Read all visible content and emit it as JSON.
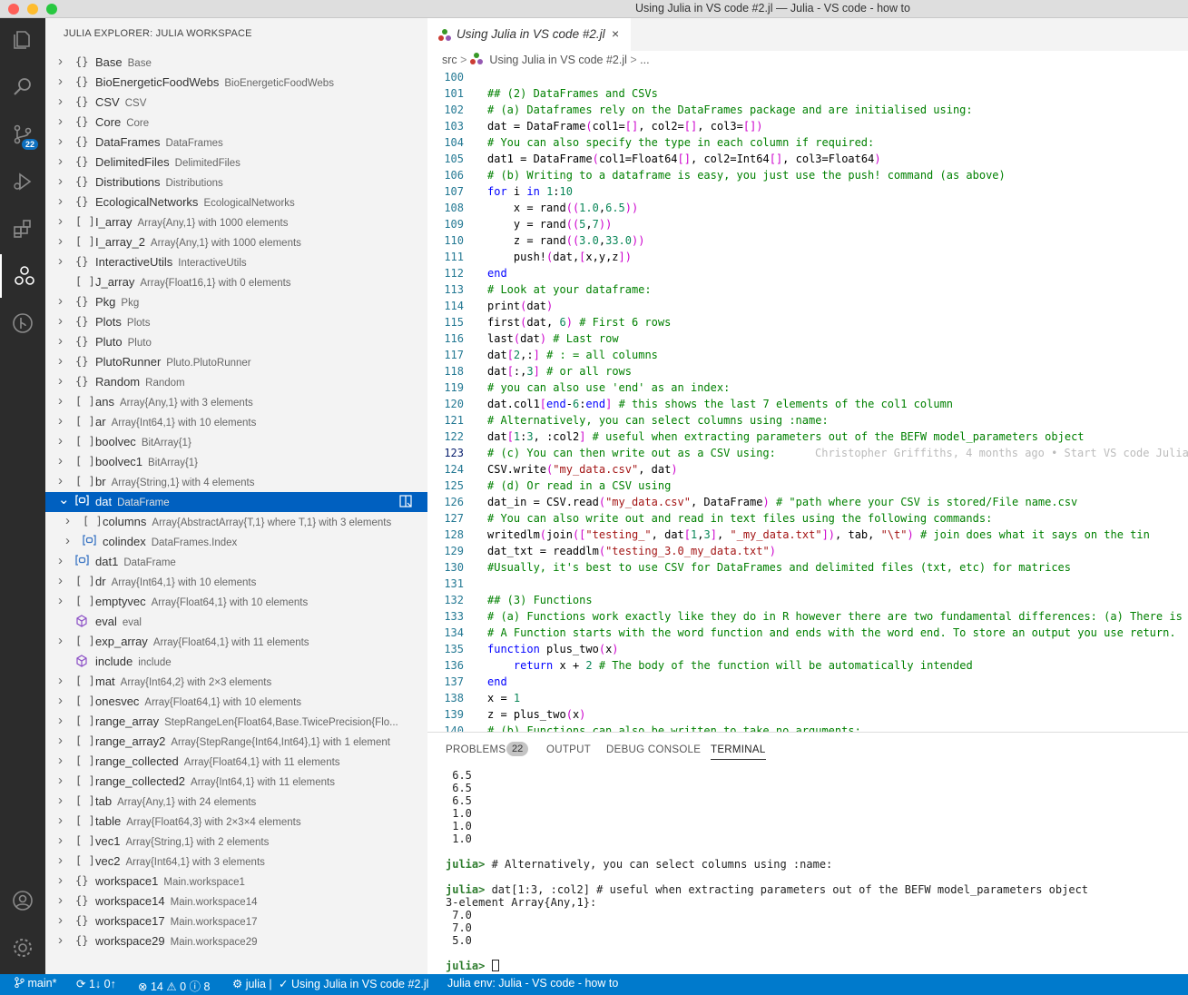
{
  "window": {
    "title": "Using Julia in VS code #2.jl — Julia - VS code - how to"
  },
  "activity": {
    "scm_badge": "22"
  },
  "explorer": {
    "title": "JULIA EXPLORER: JULIA WORKSPACE",
    "items": [
      {
        "icon": "{}",
        "name": "Base",
        "desc": "Base",
        "tw": ">"
      },
      {
        "icon": "{}",
        "name": "BioEnergeticFoodWebs",
        "desc": "BioEnergeticFoodWebs",
        "tw": ">"
      },
      {
        "icon": "{}",
        "name": "CSV",
        "desc": "CSV",
        "tw": ">"
      },
      {
        "icon": "{}",
        "name": "Core",
        "desc": "Core",
        "tw": ">"
      },
      {
        "icon": "{}",
        "name": "DataFrames",
        "desc": "DataFrames",
        "tw": ">"
      },
      {
        "icon": "{}",
        "name": "DelimitedFiles",
        "desc": "DelimitedFiles",
        "tw": ">"
      },
      {
        "icon": "{}",
        "name": "Distributions",
        "desc": "Distributions",
        "tw": ">"
      },
      {
        "icon": "{}",
        "name": "EcologicalNetworks",
        "desc": "EcologicalNetworks",
        "tw": ">"
      },
      {
        "icon": "[ ]",
        "name": "I_array",
        "desc": "Array{Any,1} with 1000 elements",
        "tw": ">"
      },
      {
        "icon": "[ ]",
        "name": "I_array_2",
        "desc": "Array{Any,1} with 1000 elements",
        "tw": ">"
      },
      {
        "icon": "{}",
        "name": "InteractiveUtils",
        "desc": "InteractiveUtils",
        "tw": ">"
      },
      {
        "icon": "[ ]",
        "name": "J_array",
        "desc": "Array{Float16,1} with 0 elements",
        "tw": ""
      },
      {
        "icon": "{}",
        "name": "Pkg",
        "desc": "Pkg",
        "tw": ">"
      },
      {
        "icon": "{}",
        "name": "Plots",
        "desc": "Plots",
        "tw": ">"
      },
      {
        "icon": "{}",
        "name": "Pluto",
        "desc": "Pluto",
        "tw": ">"
      },
      {
        "icon": "{}",
        "name": "PlutoRunner",
        "desc": "Pluto.PlutoRunner",
        "tw": ">"
      },
      {
        "icon": "{}",
        "name": "Random",
        "desc": "Random",
        "tw": ">"
      },
      {
        "icon": "[ ]",
        "name": "ans",
        "desc": "Array{Any,1} with 3 elements",
        "tw": ">"
      },
      {
        "icon": "[ ]",
        "name": "ar",
        "desc": "Array{Int64,1} with 10 elements",
        "tw": ">"
      },
      {
        "icon": "[ ]",
        "name": "boolvec",
        "desc": "BitArray{1}",
        "tw": ">"
      },
      {
        "icon": "[ ]",
        "name": "boolvec1",
        "desc": "BitArray{1}",
        "tw": ">"
      },
      {
        "icon": "[ ]",
        "name": "br",
        "desc": "Array{String,1} with 4 elements",
        "tw": ">"
      },
      {
        "icon": "[o]",
        "name": "dat",
        "desc": "DataFrame",
        "tw": "v",
        "sel": true
      },
      {
        "icon": "[ ]",
        "name": "columns",
        "desc": "Array{AbstractArray{T,1} where T,1} with 3 elements",
        "tw": ">",
        "indent": 1
      },
      {
        "icon": "[o]",
        "name": "colindex",
        "desc": "DataFrames.Index",
        "tw": ">",
        "indent": 1
      },
      {
        "icon": "[o]",
        "name": "dat1",
        "desc": "DataFrame",
        "tw": ">"
      },
      {
        "icon": "[ ]",
        "name": "dr",
        "desc": "Array{Int64,1} with 10 elements",
        "tw": ">"
      },
      {
        "icon": "[ ]",
        "name": "emptyvec",
        "desc": "Array{Float64,1} with 10 elements",
        "tw": ">"
      },
      {
        "icon": "cube",
        "name": "eval",
        "desc": "eval",
        "tw": ""
      },
      {
        "icon": "[ ]",
        "name": "exp_array",
        "desc": "Array{Float64,1} with 11 elements",
        "tw": ">"
      },
      {
        "icon": "cube",
        "name": "include",
        "desc": "include",
        "tw": ""
      },
      {
        "icon": "[ ]",
        "name": "mat",
        "desc": "Array{Int64,2} with 2×3 elements",
        "tw": ">"
      },
      {
        "icon": "[ ]",
        "name": "onesvec",
        "desc": "Array{Float64,1} with 10 elements",
        "tw": ">"
      },
      {
        "icon": "[ ]",
        "name": "range_array",
        "desc": "StepRangeLen{Float64,Base.TwicePrecision{Flo...",
        "tw": ">"
      },
      {
        "icon": "[ ]",
        "name": "range_array2",
        "desc": "Array{StepRange{Int64,Int64},1} with 1 element",
        "tw": ">"
      },
      {
        "icon": "[ ]",
        "name": "range_collected",
        "desc": "Array{Float64,1} with 11 elements",
        "tw": ">"
      },
      {
        "icon": "[ ]",
        "name": "range_collected2",
        "desc": "Array{Int64,1} with 11 elements",
        "tw": ">"
      },
      {
        "icon": "[ ]",
        "name": "tab",
        "desc": "Array{Any,1} with 24 elements",
        "tw": ">"
      },
      {
        "icon": "[ ]",
        "name": "table",
        "desc": "Array{Float64,3} with 2×3×4 elements",
        "tw": ">"
      },
      {
        "icon": "[ ]",
        "name": "vec1",
        "desc": "Array{String,1} with 2 elements",
        "tw": ">"
      },
      {
        "icon": "[ ]",
        "name": "vec2",
        "desc": "Array{Int64,1} with 3 elements",
        "tw": ">"
      },
      {
        "icon": "{}",
        "name": "workspace1",
        "desc": "Main.workspace1",
        "tw": ">"
      },
      {
        "icon": "{}",
        "name": "workspace14",
        "desc": "Main.workspace14",
        "tw": ">"
      },
      {
        "icon": "{}",
        "name": "workspace17",
        "desc": "Main.workspace17",
        "tw": ">"
      },
      {
        "icon": "{}",
        "name": "workspace29",
        "desc": "Main.workspace29",
        "tw": ">"
      }
    ]
  },
  "editor": {
    "tab_label": "Using Julia in VS code #2.jl",
    "tab_close": "×",
    "breadcrumb": {
      "folder": "src",
      "file": "Using Julia in VS code #2.jl",
      "more": "..."
    },
    "current_line": 123,
    "lines": [
      {
        "n": 100,
        "t": ""
      },
      {
        "n": 101,
        "t": "## (2) DataFrames and CSVs"
      },
      {
        "n": 102,
        "t": "# (a) Dataframes rely on the DataFrames package and are initialised using:"
      },
      {
        "n": 103,
        "t": "dat = DataFrame(col1=[], col2=[], col3=[])"
      },
      {
        "n": 104,
        "t": "# You can also specify the type in each column if required:"
      },
      {
        "n": 105,
        "t": "dat1 = DataFrame(col1=Float64[], col2=Int64[], col3=Float64)"
      },
      {
        "n": 106,
        "t": "# (b) Writing to a dataframe is easy, you just use the push! command (as above)"
      },
      {
        "n": 107,
        "t": "for i in 1:10"
      },
      {
        "n": 108,
        "t": "    x = rand((1.0,6.5))"
      },
      {
        "n": 109,
        "t": "    y = rand((5,7))"
      },
      {
        "n": 110,
        "t": "    z = rand((3.0,33.0))"
      },
      {
        "n": 111,
        "t": "    push!(dat,[x,y,z])"
      },
      {
        "n": 112,
        "t": "end"
      },
      {
        "n": 113,
        "t": "# Look at your dataframe:"
      },
      {
        "n": 114,
        "t": "print(dat)"
      },
      {
        "n": 115,
        "t": "first(dat, 6) # First 6 rows"
      },
      {
        "n": 116,
        "t": "last(dat) # Last row"
      },
      {
        "n": 117,
        "t": "dat[2,:] # : = all columns"
      },
      {
        "n": 118,
        "t": "dat[:,3] # or all rows"
      },
      {
        "n": 119,
        "t": "# you can also use 'end' as an index:"
      },
      {
        "n": 120,
        "t": "dat.col1[end-6:end] # this shows the last 7 elements of the col1 column"
      },
      {
        "n": 121,
        "t": "# Alternatively, you can select columns using :name:"
      },
      {
        "n": 122,
        "t": "dat[1:3, :col2] # useful when extracting parameters out of the BEFW model_parameters object"
      },
      {
        "n": 123,
        "t": "# (c) You can then write out as a CSV using:",
        "git": "Christopher Griffiths, 4 months ago • Start VS code Julia"
      },
      {
        "n": 124,
        "t": "CSV.write(\"my_data.csv\", dat)"
      },
      {
        "n": 125,
        "t": "# (d) Or read in a CSV using"
      },
      {
        "n": 126,
        "t": "dat_in = CSV.read(\"my_data.csv\", DataFrame) # \"path where your CSV is stored/File name.csv"
      },
      {
        "n": 127,
        "t": "# You can also write out and read in text files using the following commands:"
      },
      {
        "n": 128,
        "t": "writedlm(join([\"testing_\", dat[1,3], \"_my_data.txt\"]), tab, \"\\t\") # join does what it says on the tin"
      },
      {
        "n": 129,
        "t": "dat_txt = readdlm(\"testing_3.0_my_data.txt\")"
      },
      {
        "n": 130,
        "t": "#Usually, it's best to use CSV for DataFrames and delimited files (txt, etc) for matrices"
      },
      {
        "n": 131,
        "t": ""
      },
      {
        "n": 132,
        "t": "## (3) Functions"
      },
      {
        "n": 133,
        "t": "# (a) Functions work exactly like they do in R however there are two fundamental differences: (a) There is"
      },
      {
        "n": 134,
        "t": "# A Function starts with the word function and ends with the word end. To store an output you use return."
      },
      {
        "n": 135,
        "t": "function plus_two(x)"
      },
      {
        "n": 136,
        "t": "    return x + 2 # The body of the function will be automatically intended"
      },
      {
        "n": 137,
        "t": "end"
      },
      {
        "n": 138,
        "t": "x = 1"
      },
      {
        "n": 139,
        "t": "z = plus_two(x)"
      },
      {
        "n": 140,
        "t": "# (b) Functions can also be written to take no arguments:"
      }
    ]
  },
  "panel": {
    "tabs": [
      "PROBLEMS",
      "OUTPUT",
      "DEBUG CONSOLE",
      "TERMINAL"
    ],
    "problems_count": "22",
    "terminal": [
      {
        "t": " 6.5"
      },
      {
        "t": " 6.5"
      },
      {
        "t": " 6.5"
      },
      {
        "t": " 1.0"
      },
      {
        "t": " 1.0"
      },
      {
        "t": " 1.0"
      },
      {
        "t": ""
      },
      {
        "p": "julia>",
        "t": " # Alternatively, you can select columns using :name:"
      },
      {
        "t": ""
      },
      {
        "p": "julia>",
        "t": " dat[1:3, :col2] # useful when extracting parameters out of the BEFW model_parameters object"
      },
      {
        "t": "3-element Array{Any,1}:"
      },
      {
        "t": " 7.0"
      },
      {
        "t": " 7.0"
      },
      {
        "t": " 5.0"
      },
      {
        "t": ""
      },
      {
        "p": "julia>",
        "t": " ",
        "cursor": true
      }
    ]
  },
  "status": {
    "branch": "main*",
    "sync": "1↓ 0↑",
    "errors": "14",
    "warnings": "0",
    "infos": "8",
    "julia": "julia |",
    "file": "✓ Using Julia in VS code #2.jl",
    "env": "Julia env: Julia - VS code - how to"
  },
  "colors": {
    "accent": "#007acc",
    "selection": "#0060c0"
  }
}
